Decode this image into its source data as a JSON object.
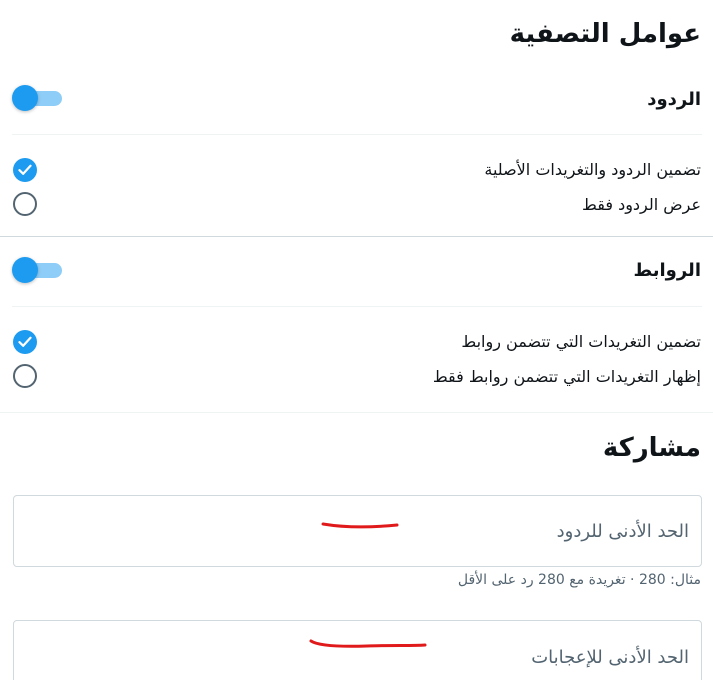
{
  "filters": {
    "title": "عوامل التصفية",
    "replies": {
      "label": "الردود",
      "options": [
        "تضمين الردود والتغريدات الأصلية",
        "عرض الردود فقط"
      ]
    },
    "links": {
      "label": "الروابط",
      "options": [
        "تضمين التغريدات التي تتضمن روابط",
        "إظهار التغريدات التي تتضمن روابط فقط"
      ]
    }
  },
  "engagement": {
    "title": "مشاركة",
    "min_replies": {
      "placeholder": "الحد الأدنى للردود",
      "hint": "مثال: 280 · تغريدة مع 280 رد على الأقل"
    },
    "min_likes": {
      "placeholder": "الحد الأدنى للإعجابات"
    }
  },
  "colors": {
    "accent": "#1d9bf0",
    "annotation": "#e0191b"
  }
}
